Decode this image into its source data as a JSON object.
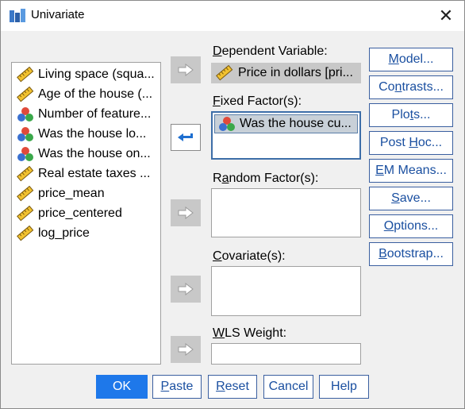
{
  "window": {
    "title": "Univariate",
    "close_glyph": "✕"
  },
  "source_list": {
    "items": [
      {
        "label": "Living space (squa...",
        "icon": "scale-icon"
      },
      {
        "label": "Age of the house (...",
        "icon": "scale-icon"
      },
      {
        "label": "Number of feature...",
        "icon": "nominal-icon"
      },
      {
        "label": "Was the house lo...",
        "icon": "nominal-icon"
      },
      {
        "label": "Was the house on...",
        "icon": "nominal-icon"
      },
      {
        "label": "Real estate taxes ...",
        "icon": "scale-icon"
      },
      {
        "label": "price_mean",
        "icon": "scale-icon"
      },
      {
        "label": "price_centered",
        "icon": "scale-icon"
      },
      {
        "label": "log_price",
        "icon": "scale-icon"
      }
    ]
  },
  "fields": {
    "dependent": {
      "label_key": "D",
      "label_rest": "ependent Variable:",
      "value": "Price in dollars [pri..."
    },
    "fixed": {
      "label_key": "F",
      "label_rest": "ixed Factor(s):",
      "items": [
        "Was the house cu..."
      ]
    },
    "random": {
      "label_pre": "R",
      "label_key": "a",
      "label_rest": "ndom Factor(s):"
    },
    "covariate": {
      "label_key": "C",
      "label_rest": "ovariate(s):"
    },
    "wls": {
      "label_key": "W",
      "label_rest": "LS Weight:"
    }
  },
  "side_buttons": [
    {
      "pre": "",
      "key": "M",
      "post": "odel..."
    },
    {
      "pre": "Co",
      "key": "n",
      "post": "trasts..."
    },
    {
      "pre": "Plo",
      "key": "t",
      "post": "s..."
    },
    {
      "pre": "Post ",
      "key": "H",
      "post": "oc..."
    },
    {
      "pre": "",
      "key": "E",
      "post": "M Means..."
    },
    {
      "pre": "",
      "key": "S",
      "post": "ave..."
    },
    {
      "pre": "",
      "key": "O",
      "post": "ptions..."
    },
    {
      "pre": "",
      "key": "B",
      "post": "ootstrap..."
    }
  ],
  "bottom_buttons": {
    "ok": "OK",
    "paste": {
      "key": "P",
      "post": "aste"
    },
    "reset": {
      "key": "R",
      "post": "eset"
    },
    "cancel": "Cancel",
    "help": "Help"
  },
  "colors": {
    "accent": "#1e78ea",
    "link_text": "#1a4fa0",
    "disabled_arrow": "#c8c8c8",
    "active_arrow": "#1e6fd0"
  }
}
